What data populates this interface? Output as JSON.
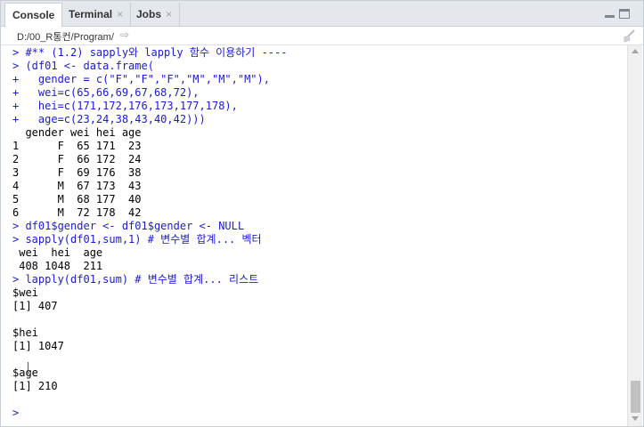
{
  "tabs": [
    {
      "label": "Console",
      "closable": false
    },
    {
      "label": "Terminal",
      "closable": true
    },
    {
      "label": "Jobs",
      "closable": true
    }
  ],
  "close_glyph": "×",
  "path": {
    "text": "D:/00_R통컨/Program/",
    "arrow": "⇨"
  },
  "console_lines": [
    {
      "kind": "input",
      "text": "> #** (1.2) sapply와 lapply 함수 이용하기 ----"
    },
    {
      "kind": "input",
      "text": "> (df01 <- data.frame("
    },
    {
      "kind": "input",
      "text": "+   gender = c(\"F\",\"F\",\"F\",\"M\",\"M\",\"M\"),"
    },
    {
      "kind": "input",
      "text": "+   wei=c(65,66,69,67,68,72),"
    },
    {
      "kind": "input",
      "text": "+   hei=c(171,172,176,173,177,178),"
    },
    {
      "kind": "input",
      "text": "+   age=c(23,24,38,43,40,42)))"
    },
    {
      "kind": "output",
      "text": "  gender wei hei age"
    },
    {
      "kind": "output",
      "text": "1      F  65 171  23"
    },
    {
      "kind": "output",
      "text": "2      F  66 172  24"
    },
    {
      "kind": "output",
      "text": "3      F  69 176  38"
    },
    {
      "kind": "output",
      "text": "4      M  67 173  43"
    },
    {
      "kind": "output",
      "text": "5      M  68 177  40"
    },
    {
      "kind": "output",
      "text": "6      M  72 178  42"
    },
    {
      "kind": "input",
      "text": "> df01$gender <- df01$gender <- NULL"
    },
    {
      "kind": "input",
      "text": "> sapply(df01,sum,1) # 변수별 합계... 벡터"
    },
    {
      "kind": "output",
      "text": " wei  hei  age "
    },
    {
      "kind": "output",
      "text": " 408 1048  211 "
    },
    {
      "kind": "input",
      "text": "> lapply(df01,sum) # 변수별 합계... 리스트"
    },
    {
      "kind": "output",
      "text": "$wei"
    },
    {
      "kind": "output",
      "text": "[1] 407"
    },
    {
      "kind": "output",
      "text": ""
    },
    {
      "kind": "output",
      "text": "$hei"
    },
    {
      "kind": "output",
      "text": "[1] 1047"
    },
    {
      "kind": "output",
      "text": ""
    },
    {
      "kind": "output",
      "text": "$age"
    },
    {
      "kind": "output",
      "text": "[1] 210"
    },
    {
      "kind": "output",
      "text": ""
    },
    {
      "kind": "input",
      "text": "> "
    }
  ],
  "colors": {
    "input": "#1a1ad6",
    "output": "#000000",
    "tabbar": "#e4e8ec"
  },
  "icons": {
    "minimize": "minimize-pane-icon",
    "maximize": "maximize-pane-icon",
    "clear": "broom-clear-console-icon",
    "path_go": "go-to-directory-icon"
  }
}
